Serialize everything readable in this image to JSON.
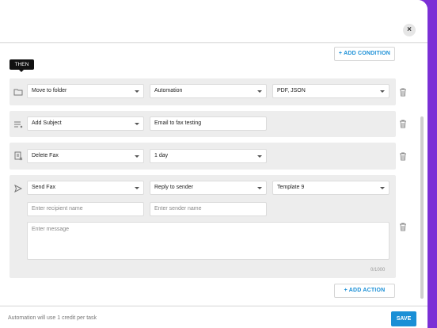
{
  "header": {
    "close_icon": "×"
  },
  "buttons": {
    "add_condition": "+ ADD CONDITION",
    "add_action": "+ ADD ACTION",
    "save": "SAVE"
  },
  "then_badge": "THEN",
  "actions": [
    {
      "icon": "folder-icon",
      "fields": [
        "Move to folder",
        "Automation",
        "PDF, JSON"
      ]
    },
    {
      "icon": "text-lines-icon",
      "fields": [
        "Add Subject",
        "Email to fax testing"
      ]
    },
    {
      "icon": "delete-fax-icon",
      "fields": [
        "Delete Fax",
        "1 day"
      ]
    },
    {
      "icon": "send-icon",
      "fields": [
        "Send Fax",
        "Reply to sender",
        "Template 9"
      ],
      "recipient_placeholder": "Enter recipient name",
      "sender_placeholder": "Enter sender name",
      "message_placeholder": "Enter message",
      "counter": "0/1000"
    }
  ],
  "footer": {
    "note": "Automation will use 1 credit per task"
  },
  "colors": {
    "accent": "#1a8fd6",
    "frame": "#7b2fd6"
  }
}
